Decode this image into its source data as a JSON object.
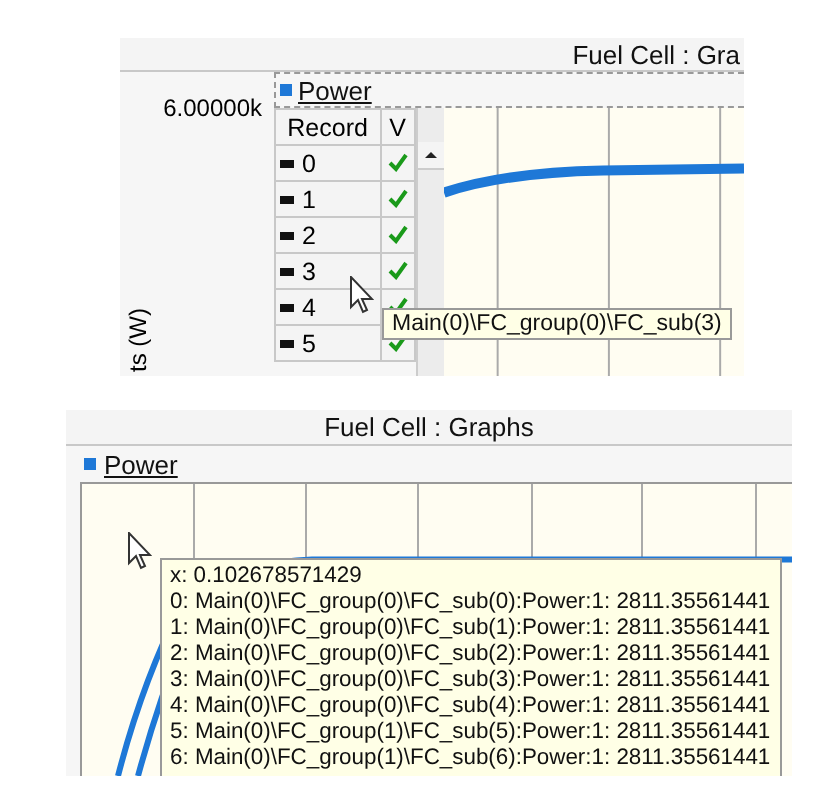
{
  "panels": [
    {
      "kind": "record-table",
      "title": "Fuel Cell : Gra",
      "y_max_label": "6.00000k",
      "y_axis_label": "ts (W)",
      "legend": {
        "label": "Power",
        "color": "#1e78d7"
      },
      "table": {
        "columns": [
          "Record",
          "V"
        ],
        "rows": [
          {
            "record": "0",
            "checked": true
          },
          {
            "record": "1",
            "checked": true
          },
          {
            "record": "2",
            "checked": true
          },
          {
            "record": "3",
            "checked": true
          },
          {
            "record": "4",
            "checked": true
          },
          {
            "record": "5",
            "checked": true
          }
        ]
      },
      "tooltip": {
        "lines": [
          "Main(0)\\FC_group(0)\\FC_sub(3)"
        ]
      }
    },
    {
      "kind": "value-tooltip",
      "title": "Fuel Cell : Graphs",
      "legend": {
        "label": "Power",
        "color": "#1e78d7"
      },
      "tooltip": {
        "lines": [
          "x: 0.102678571429",
          "0: Main(0)\\FC_group(0)\\FC_sub(0):Power:1: 2811.35561441",
          "1: Main(0)\\FC_group(0)\\FC_sub(1):Power:1: 2811.35561441",
          "2: Main(0)\\FC_group(0)\\FC_sub(2):Power:1: 2811.35561441",
          "3: Main(0)\\FC_group(0)\\FC_sub(3):Power:1: 2811.35561441",
          "4: Main(0)\\FC_group(0)\\FC_sub(4):Power:1: 2811.35561441",
          "5: Main(0)\\FC_group(1)\\FC_sub(5):Power:1: 2811.35561441",
          "6: Main(0)\\FC_group(1)\\FC_sub(6):Power:1: 2811.35561441"
        ]
      }
    }
  ]
}
